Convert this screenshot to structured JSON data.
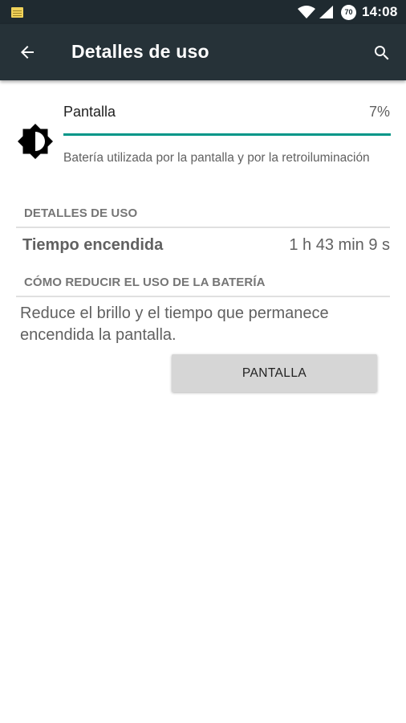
{
  "status_bar": {
    "time": "14:08",
    "battery_level": "70",
    "notification_icon": "notes-icon",
    "wifi_icon": "wifi-icon",
    "signal_icon": "cell-signal-icon"
  },
  "app_bar": {
    "title": "Detalles de uso",
    "back_icon": "arrow-back-icon",
    "search_icon": "search-icon",
    "background_color": "#263238"
  },
  "usage_item": {
    "icon": "brightness-icon",
    "title": "Pantalla",
    "percent_label": "7%",
    "percent_value": 7,
    "summary": "Batería utilizada por la pantalla y por la retroiluminación",
    "bar_color": "#009688"
  },
  "usage_details": {
    "header": "DETALLES DE USO",
    "rows": [
      {
        "label": "Tiempo encendida",
        "value": "1 h 43 min 9 s"
      }
    ]
  },
  "reduce_usage": {
    "header": "CÓMO REDUCIR EL USO DE LA BATERÍA",
    "tip": "Reduce el brillo y el tiempo que permanece encendida la pantalla.",
    "button_label": "PANTALLA"
  }
}
